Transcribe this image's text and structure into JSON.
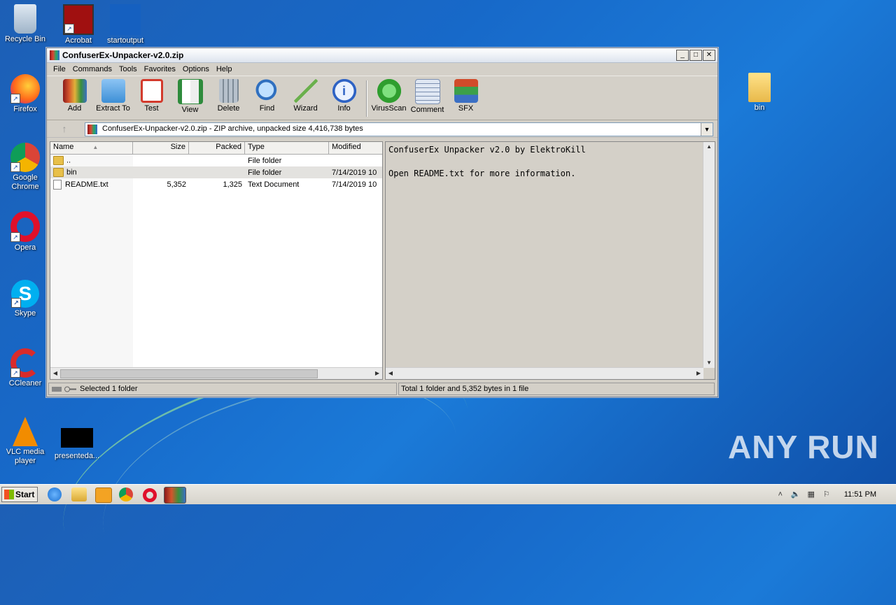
{
  "desktop": {
    "icons": [
      {
        "label": "Recycle Bin"
      },
      {
        "label": "Acrobat"
      },
      {
        "label": "startoutput"
      },
      {
        "label": "Firefox"
      },
      {
        "label": "Google Chrome"
      },
      {
        "label": "Opera"
      },
      {
        "label": "Skype"
      },
      {
        "label": "CCleaner"
      },
      {
        "label": "VLC media player"
      },
      {
        "label": "presenteda..."
      },
      {
        "label": "bin"
      }
    ],
    "watermark": "ANY RUN"
  },
  "window": {
    "title": "ConfuserEx-Unpacker-v2.0.zip",
    "buttons": {
      "minimize": "_",
      "maximize": "□",
      "close": "✕"
    },
    "menu": [
      "File",
      "Commands",
      "Tools",
      "Favorites",
      "Options",
      "Help"
    ],
    "toolbar": [
      {
        "label": "Add",
        "icon": "add-archive-icon",
        "color": "#c23b22"
      },
      {
        "label": "Extract To",
        "icon": "extract-folder-icon",
        "color": "#3d8fd6"
      },
      {
        "label": "Test",
        "icon": "test-clipboard-icon",
        "color": "#d33a2c"
      },
      {
        "label": "View",
        "icon": "view-book-icon",
        "color": "#2e8b3c"
      },
      {
        "label": "Delete",
        "icon": "delete-trash-icon",
        "color": "#7d8a96"
      },
      {
        "label": "Find",
        "icon": "find-magnifier-icon",
        "color": "#2f6fbf"
      },
      {
        "label": "Wizard",
        "icon": "wizard-wand-icon",
        "color": "#6ab04c"
      },
      {
        "label": "Info",
        "icon": "info-icon",
        "color": "#2d62c4"
      },
      {
        "label": "VirusScan",
        "icon": "virusscan-bug-icon",
        "color": "#2f9e2f"
      },
      {
        "label": "Comment",
        "icon": "comment-icon",
        "color": "#7b8fb0"
      },
      {
        "label": "SFX",
        "icon": "sfx-books-icon",
        "color": "#d14b2a"
      }
    ],
    "address": "ConfuserEx-Unpacker-v2.0.zip - ZIP archive, unpacked size 4,416,738 bytes",
    "columns": [
      "Name",
      "Size",
      "Packed",
      "Type",
      "Modified"
    ],
    "files": [
      {
        "name": "..",
        "size": "",
        "packed": "",
        "type": "File folder",
        "modified": "",
        "kind": "folder"
      },
      {
        "name": "bin",
        "size": "",
        "packed": "",
        "type": "File folder",
        "modified": "7/14/2019 10",
        "kind": "folder"
      },
      {
        "name": "README.txt",
        "size": "5,352",
        "packed": "1,325",
        "type": "Text Document",
        "modified": "7/14/2019 10",
        "kind": "text"
      }
    ],
    "comment_lines": [
      "ConfuserEx Unpacker v2.0 by ElektroKill",
      "",
      "Open README.txt for more information."
    ],
    "status_left": "Selected 1 folder",
    "status_right": "Total 1 folder and 5,352 bytes in 1 file"
  },
  "taskbar": {
    "start": "Start",
    "clock": "11:51 PM"
  }
}
